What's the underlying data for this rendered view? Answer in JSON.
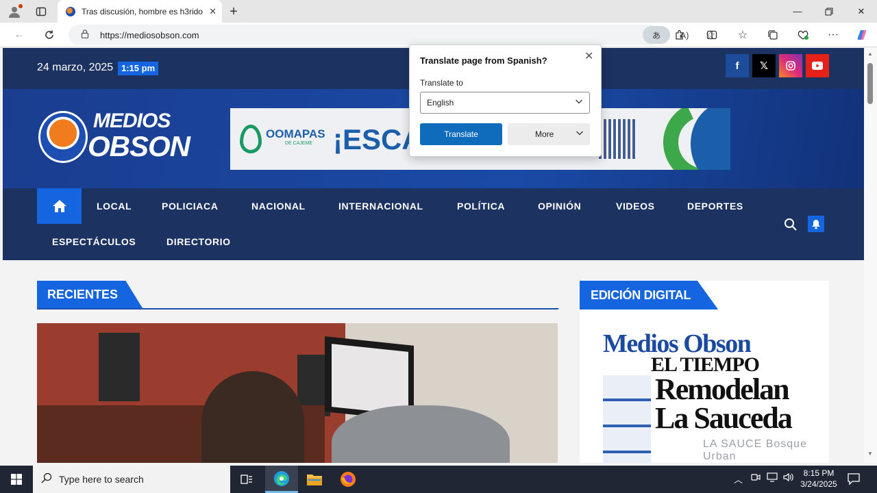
{
  "browser": {
    "tab_title": "Tras discusión, hombre es h3rido",
    "url": "https://mediosobson.com",
    "translate_glyph": "あ",
    "read_aloud_glyph": "A"
  },
  "translate_popup": {
    "title": "Translate page from Spanish?",
    "label": "Translate to",
    "selected_language": "English",
    "translate_button": "Translate",
    "more_button": "More"
  },
  "site": {
    "date": "24 marzo, 2025",
    "time": "1:15 pm",
    "social": [
      "facebook-icon",
      "x-icon",
      "instagram-icon",
      "youtube-icon"
    ],
    "logo_line1": "MEDIOS",
    "logo_line2": "OBSON",
    "banner": {
      "brand": "OOMAPAS",
      "brand_sub": "DE CAJEME",
      "slogan": "¡ESCA"
    },
    "nav": {
      "items": [
        "LOCAL",
        "POLICIACA",
        "NACIONAL",
        "INTERNACIONAL",
        "POLÍTICA",
        "OPINIÓN",
        "VIDEOS",
        "DEPORTES",
        "ESPECTÁCULOS",
        "DIRECTORIO"
      ]
    },
    "recent_heading": "RECIENTES",
    "digital_heading": "EDICIÓN DIGITAL",
    "paper": {
      "brand": "Medios Obson",
      "name": "EL TIEMPO",
      "headline_1": "Remodelan",
      "headline_2": "La Sauceda",
      "subtext": "LA SAUCE Bosque Urban"
    }
  },
  "taskbar": {
    "search_placeholder": "Type here to search",
    "time": "8:15 PM",
    "date": "3/24/2025"
  },
  "colors": {
    "site_navy": "#1c3260",
    "site_accent": "#1565e0",
    "edge_blue": "#0f6cbd"
  }
}
